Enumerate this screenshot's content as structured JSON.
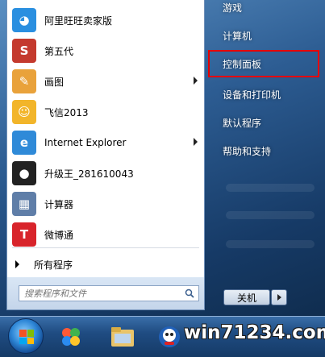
{
  "programs": [
    {
      "label": "阿里旺旺卖家版",
      "icon": "aliwangwang-icon",
      "color": "#2a8fe0",
      "glyph": "◕",
      "has_arrow": false
    },
    {
      "label": "第五代",
      "icon": "fifth-gen-icon",
      "color": "#c43a2e",
      "glyph": "S",
      "has_arrow": false
    },
    {
      "label": "画图",
      "icon": "paint-icon",
      "color": "#e9a23b",
      "glyph": "✎",
      "has_arrow": true
    },
    {
      "label": "飞信2013",
      "icon": "fetion-icon",
      "color": "#f2b52a",
      "glyph": "☺",
      "has_arrow": false
    },
    {
      "label": "Internet Explorer",
      "icon": "internet-explorer-icon",
      "color": "#2f8ad8",
      "glyph": "e",
      "has_arrow": true
    },
    {
      "label": "升级王_281610043",
      "icon": "penguin-icon",
      "color": "#222222",
      "glyph": "●",
      "has_arrow": false
    },
    {
      "label": "计算器",
      "icon": "calculator-icon",
      "color": "#5f7ea8",
      "glyph": "▦",
      "has_arrow": false
    },
    {
      "label": "微博通",
      "icon": "weibotong-icon",
      "color": "#d8242b",
      "glyph": "T",
      "has_arrow": false
    }
  ],
  "all_programs": "所有程序",
  "search": {
    "placeholder": "搜索程序和文件"
  },
  "right_items": [
    {
      "label": "游戏",
      "highlighted": false
    },
    {
      "label": "计算机",
      "highlighted": false
    },
    {
      "label": "控制面板",
      "highlighted": true
    },
    {
      "label": "设备和打印机",
      "highlighted": false
    },
    {
      "label": "默认程序",
      "highlighted": false
    },
    {
      "label": "帮助和支持",
      "highlighted": false
    }
  ],
  "shutdown": {
    "label": "关机"
  },
  "taskbar": {
    "start_icon": "windows-orb-icon",
    "apps": [
      "colorful-balls-icon",
      "file-explorer-icon",
      "qq-game-icon",
      "media-icon"
    ]
  },
  "watermark": "win71234.com",
  "colors": {
    "highlight_border": "#e60000",
    "pane_bg": "#ffffff"
  }
}
